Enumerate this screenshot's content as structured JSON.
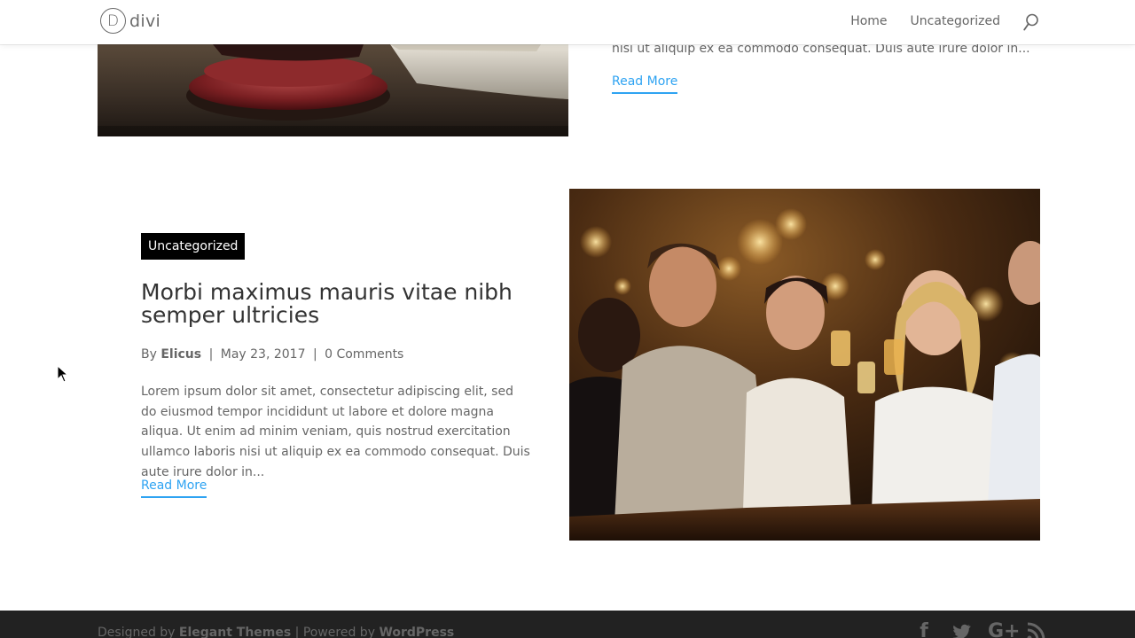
{
  "header": {
    "logo_letter": "D",
    "logo_text": "divi",
    "nav": [
      {
        "label": "Home"
      },
      {
        "label": "Uncategorized"
      }
    ]
  },
  "post_prev": {
    "excerpt_tail": "nisi ut aliquip ex ea commodo consequat. Duis aute irure dolor in...",
    "read_more": "Read More"
  },
  "post": {
    "category": "Uncategorized",
    "title": "Morbi maximus mauris vitae nibh semper ultricies",
    "meta": {
      "by": "By",
      "author": "Elicus",
      "separator": "|",
      "date": "May 23, 2017",
      "comments": "0 Comments"
    },
    "excerpt": "Lorem ipsum dolor sit amet, consectetur adipiscing elit, sed do eiusmod tempor incididunt ut labore et dolore magna aliqua. Ut enim ad minim veniam, quis nostrud exercitation ullamco laboris nisi ut aliquip ex ea commodo consequat. Duis aute irure dolor in...",
    "read_more": "Read More"
  },
  "footer": {
    "designed_by": "Designed by",
    "elegant_themes": "Elegant Themes",
    "powered_sep": "| Powered by",
    "wordpress": "WordPress",
    "socials": [
      {
        "icon": "facebook-icon",
        "glyph": "f"
      },
      {
        "icon": "twitter-icon",
        "glyph": ""
      },
      {
        "icon": "google-plus-icon",
        "glyph": "G+"
      },
      {
        "icon": "rss-icon",
        "glyph": ""
      }
    ]
  },
  "colors": {
    "accent": "#2ea3f2",
    "text": "#666666",
    "heading": "#333333",
    "footer_bg": "#222222",
    "badge_bg": "#000000"
  }
}
